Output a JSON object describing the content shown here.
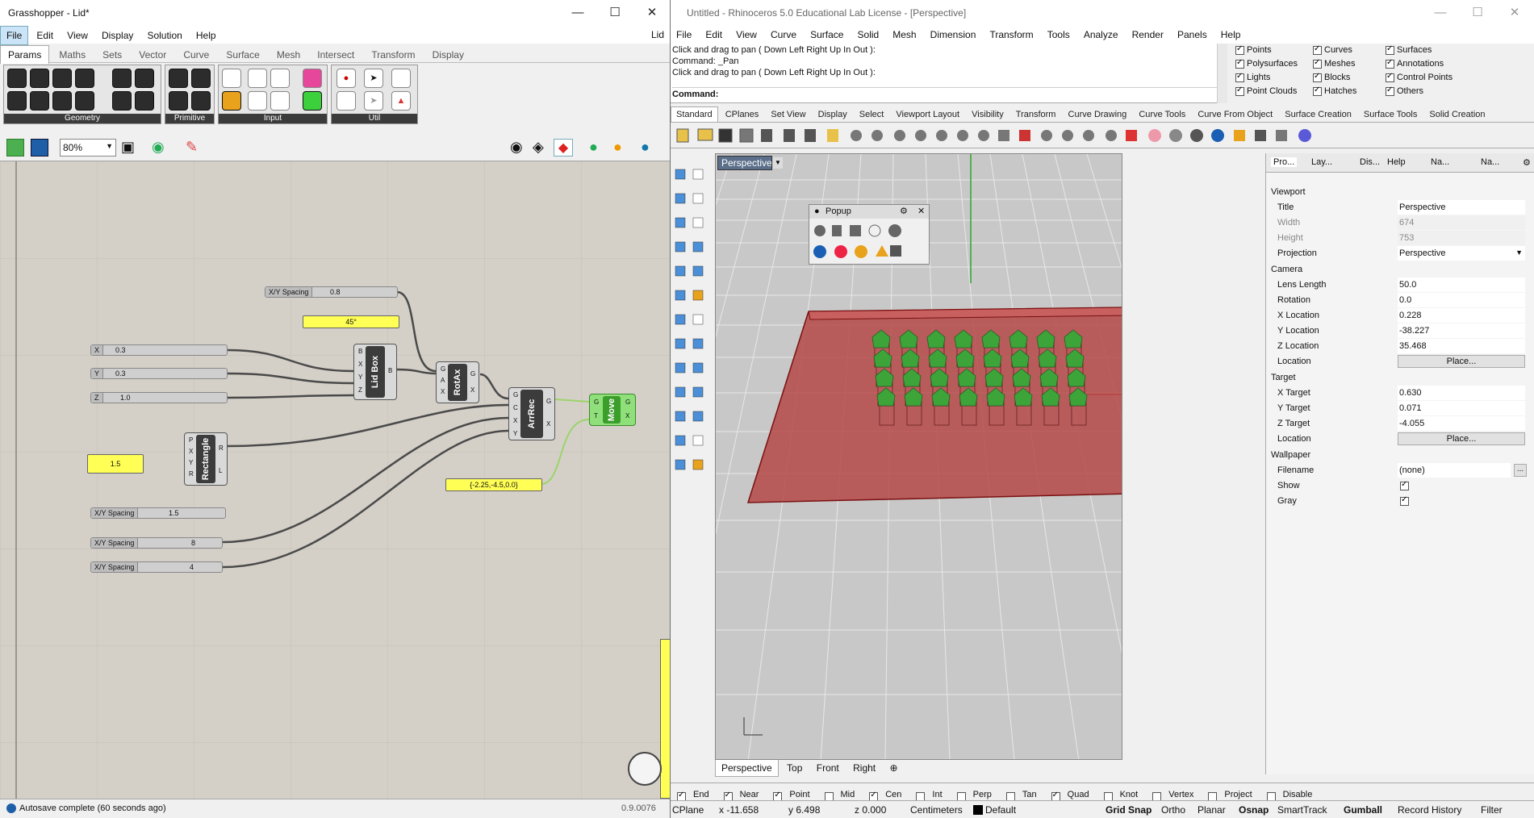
{
  "gh": {
    "title": "Grasshopper - Lid*",
    "menu": [
      "File",
      "Edit",
      "View",
      "Display",
      "Solution",
      "Help"
    ],
    "menu_right": "Lid",
    "tabs": [
      "Params",
      "Maths",
      "Sets",
      "Vector",
      "Curve",
      "Surface",
      "Mesh",
      "Intersect",
      "Transform",
      "Display"
    ],
    "groups": [
      "Geometry",
      "Primitive",
      "Input",
      "Util"
    ],
    "zoom": "80%",
    "status": "Autosave complete (60 seconds ago)",
    "version": "0.9.0076",
    "sliders": [
      {
        "name": "X/Y Spacing",
        "value": "0.8"
      },
      {
        "name": "X",
        "value": "0.3"
      },
      {
        "name": "Y",
        "value": "0.3"
      },
      {
        "name": "Z",
        "value": "1.0"
      },
      {
        "name": "X/Y Spacing",
        "value": "1.5"
      },
      {
        "name": "X/Y Spacing",
        "value": "8"
      },
      {
        "name": "X/Y Spacing",
        "value": "4"
      }
    ],
    "panels": {
      "angle": "45°",
      "num": "1.5",
      "vec": "{-2.25,-4.5,0.0}"
    },
    "components": {
      "lidbox": {
        "label": "Lid Box",
        "in": [
          "B",
          "X",
          "Y",
          "Z"
        ],
        "out": "B"
      },
      "rotax": {
        "label": "RotAx",
        "in": [
          "G",
          "A",
          "X"
        ],
        "out": [
          "G",
          "X"
        ]
      },
      "arrrec": {
        "label": "ArrRec",
        "in": [
          "G",
          "C",
          "X",
          "Y"
        ],
        "out": [
          "G",
          "X"
        ]
      },
      "move": {
        "label": "Move",
        "in": [
          "G",
          "T"
        ],
        "out": [
          "G",
          "X"
        ]
      },
      "rect": {
        "label": "Rectangle",
        "in": [
          "P",
          "X",
          "Y",
          "R"
        ],
        "out": [
          "R",
          "L"
        ]
      }
    }
  },
  "rh": {
    "title": "Untitled - Rhinoceros 5.0 Educational Lab License - [Perspective]",
    "menu": [
      "File",
      "Edit",
      "View",
      "Curve",
      "Surface",
      "Solid",
      "Mesh",
      "Dimension",
      "Transform",
      "Tools",
      "Analyze",
      "Render",
      "Panels",
      "Help"
    ],
    "cmd": [
      "Click and drag to pan ( Down  Left  Right  Up  In  Out ):",
      "Command: _Pan",
      "Click and drag to pan ( Down  Left  Right  Up  In  Out ):"
    ],
    "cmd_prompt": "Command:",
    "filters": [
      [
        {
          "l": "Points",
          "on": true
        },
        {
          "l": "Curves",
          "on": true
        },
        {
          "l": "Surfaces",
          "on": true
        }
      ],
      [
        {
          "l": "Polysurfaces",
          "on": true
        },
        {
          "l": "Meshes",
          "on": true
        },
        {
          "l": "Annotations",
          "on": true
        }
      ],
      [
        {
          "l": "Lights",
          "on": true
        },
        {
          "l": "Blocks",
          "on": true
        },
        {
          "l": "Control Points",
          "on": true
        }
      ],
      [
        {
          "l": "Point Clouds",
          "on": true
        },
        {
          "l": "Hatches",
          "on": true
        },
        {
          "l": "Others",
          "on": true
        }
      ]
    ],
    "tabs": [
      "Standard",
      "CPlanes",
      "Set View",
      "Display",
      "Select",
      "Viewport Layout",
      "Visibility",
      "Transform",
      "Curve Drawing",
      "Curve Tools",
      "Curve From Object",
      "Surface Creation",
      "Surface Tools",
      "Solid Creation"
    ],
    "viewport_label": "Perspective",
    "popup_title": "Popup",
    "vptabs": [
      "Perspective",
      "Top",
      "Front",
      "Right"
    ],
    "osnaps": [
      {
        "l": "End",
        "on": true
      },
      {
        "l": "Near",
        "on": true
      },
      {
        "l": "Point",
        "on": true
      },
      {
        "l": "Mid",
        "on": false
      },
      {
        "l": "Cen",
        "on": true
      },
      {
        "l": "Int",
        "on": false
      },
      {
        "l": "Perp",
        "on": false
      },
      {
        "l": "Tan",
        "on": false
      },
      {
        "l": "Quad",
        "on": true
      },
      {
        "l": "Knot",
        "on": false
      },
      {
        "l": "Vertex",
        "on": false
      },
      {
        "l": "Project",
        "on": false
      },
      {
        "l": "Disable",
        "on": false
      }
    ],
    "status": {
      "cplane": "CPlane",
      "x": "x -11.658",
      "y": "y 6.498",
      "z": "z 0.000",
      "units": "Centimeters",
      "layer": "Default",
      "grid": "Grid Snap",
      "ortho": "Ortho",
      "planar": "Planar",
      "osnap": "Osnap",
      "smarttrack": "SmartTrack",
      "gumball": "Gumball",
      "history": "Record History",
      "filter": "Filter"
    },
    "ptabs": [
      "Pro...",
      "Lay...",
      "Dis...",
      "Help",
      "Na...",
      "Na..."
    ],
    "props": {
      "viewport": "Viewport",
      "title_k": "Title",
      "title_v": "Perspective",
      "width_k": "Width",
      "width_v": "674",
      "height_k": "Height",
      "height_v": "753",
      "proj_k": "Projection",
      "proj_v": "Perspective",
      "camera": "Camera",
      "lens_k": "Lens Length",
      "lens_v": "50.0",
      "rot_k": "Rotation",
      "rot_v": "0.0",
      "xl_k": "X Location",
      "xl_v": "0.228",
      "yl_k": "Y Location",
      "yl_v": "-38.227",
      "zl_k": "Z Location",
      "zl_v": "35.468",
      "loc_k": "Location",
      "place": "Place...",
      "target": "Target",
      "xt_k": "X Target",
      "xt_v": "0.630",
      "yt_k": "Y Target",
      "yt_v": "0.071",
      "zt_k": "Z Target",
      "zt_v": "-4.055",
      "wallpaper": "Wallpaper",
      "file_k": "Filename",
      "file_v": "(none)",
      "show_k": "Show",
      "gray_k": "Gray"
    }
  }
}
